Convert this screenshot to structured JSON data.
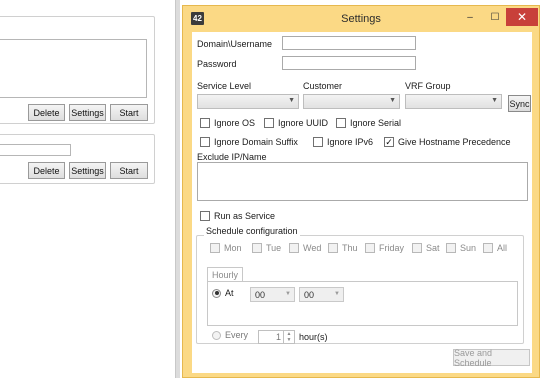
{
  "background_app": {
    "groups": [
      {
        "buttons": {
          "delete": "Delete",
          "settings": "Settings",
          "start": "Start"
        }
      },
      {
        "buttons": {
          "delete": "Delete",
          "settings": "Settings",
          "start": "Start"
        }
      }
    ]
  },
  "window": {
    "title": "Settings",
    "icon_text": "42",
    "controls": {
      "minimize": "–",
      "maximize": "☐",
      "close": "✕"
    }
  },
  "form": {
    "domain_username_label": "Domain\\Username",
    "domain_username_value": "",
    "password_label": "Password",
    "password_value": "",
    "service_level_label": "Service Level",
    "customer_label": "Customer",
    "vrf_group_label": "VRF Group",
    "sync_label": "Sync",
    "checks": {
      "ignore_os": {
        "label": "Ignore OS",
        "checked": false
      },
      "ignore_uuid": {
        "label": "Ignore UUID",
        "checked": false
      },
      "ignore_serial": {
        "label": "Ignore Serial",
        "checked": false
      },
      "ignore_domain_suffix": {
        "label": "Ignore Domain Suffix",
        "checked": false
      },
      "ignore_ipv6": {
        "label": "Ignore IPv6",
        "checked": false
      },
      "give_hostname_precedence": {
        "label": "Give Hostname Precedence",
        "checked": true
      }
    },
    "exclude_label": "Exclude IP/Name",
    "run_as_service_label": "Run as Service"
  },
  "schedule": {
    "group_label": "Schedule configuration",
    "days": [
      "Mon",
      "Tue",
      "Wed",
      "Thu",
      "Friday",
      "Sat",
      "Sun",
      "All"
    ],
    "tab_label": "Hourly",
    "at_label": "At",
    "at_hour": "00",
    "at_minute": "00",
    "every_label": "Every",
    "every_value": "1",
    "hours_label": "hour(s)",
    "save_button": "Save and Schedule"
  }
}
